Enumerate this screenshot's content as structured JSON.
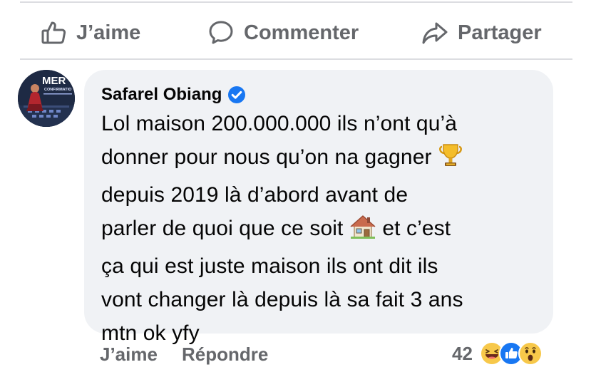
{
  "actions": {
    "like_label": "J’aime",
    "comment_label": "Commenter",
    "share_label": "Partager"
  },
  "avatar": {
    "logo_text": "MER",
    "subtext": "CONFIRMATIO"
  },
  "comment": {
    "author": "Safarel Obiang",
    "verified": true,
    "lines": [
      "Lol maison 200.000.000 ils n’ont qu’à",
      "donner pour nous qu’on na gagner",
      "depuis 2019 là d’abord avant de",
      "parler de quoi que ce soit",
      "et c’est",
      "ça qui est juste maison ils ont dit ils",
      "vont changer là depuis là sa fait 3 ans",
      "mtn ok yfy"
    ],
    "emojis": [
      "trophy",
      "house"
    ]
  },
  "meta": {
    "like_label": "J’aime",
    "reply_label": "Répondre",
    "reaction_count": "42",
    "reaction_types": [
      "haha",
      "like",
      "wow"
    ]
  },
  "colors": {
    "muted_text": "#65676b",
    "bubble_bg": "#f0f2f5",
    "verified_blue": "#1877f2",
    "divider": "#dcdde1"
  }
}
